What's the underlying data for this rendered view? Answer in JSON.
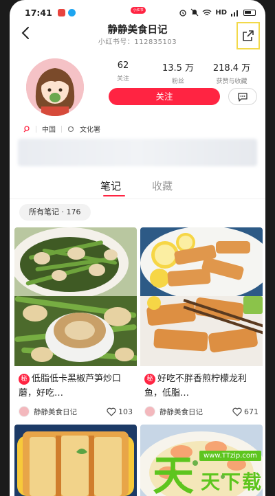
{
  "status_bar": {
    "time": "17:41",
    "pill_text": "小红书",
    "network": "HD",
    "app_colors": [
      "#e8433e",
      "#1ea5f0"
    ]
  },
  "header": {
    "title": "静静美食日记",
    "red_id": "小红书号：112835103",
    "back_icon": "chevron-left-icon",
    "share_icon": "share-icon"
  },
  "profile": {
    "stats": [
      {
        "value": "62",
        "label": "关注"
      },
      {
        "value": "13.5 万",
        "label": "粉丝"
      },
      {
        "value": "218.4 万",
        "label": "获赞与收藏"
      }
    ],
    "follow_label": "关注",
    "message_icon": "chat-bubble-icon",
    "tags": [
      {
        "icon": "location-icon",
        "text": "中国"
      },
      {
        "icon": "culture-icon",
        "text": "文化署"
      }
    ]
  },
  "tabs": [
    {
      "label": "笔记",
      "active": true
    },
    {
      "label": "收藏",
      "active": false
    }
  ],
  "filter": {
    "label": "所有笔记 · 176"
  },
  "notes": [
    {
      "badge": "秘",
      "title": "低脂低卡黑椒芦笋炒口蘑，好吃…",
      "author": "静静美食日记",
      "likes": "103"
    },
    {
      "badge": "秘",
      "title": "好吃不胖香煎柠檬龙利鱼，低脂…",
      "author": "静静美食日记",
      "likes": "671"
    }
  ],
  "watermark": {
    "char": "天",
    "url": "www.TTzip.com",
    "sub": "天下载"
  },
  "colors": {
    "accent": "#ff2442",
    "watermark": "#5dc51e"
  }
}
